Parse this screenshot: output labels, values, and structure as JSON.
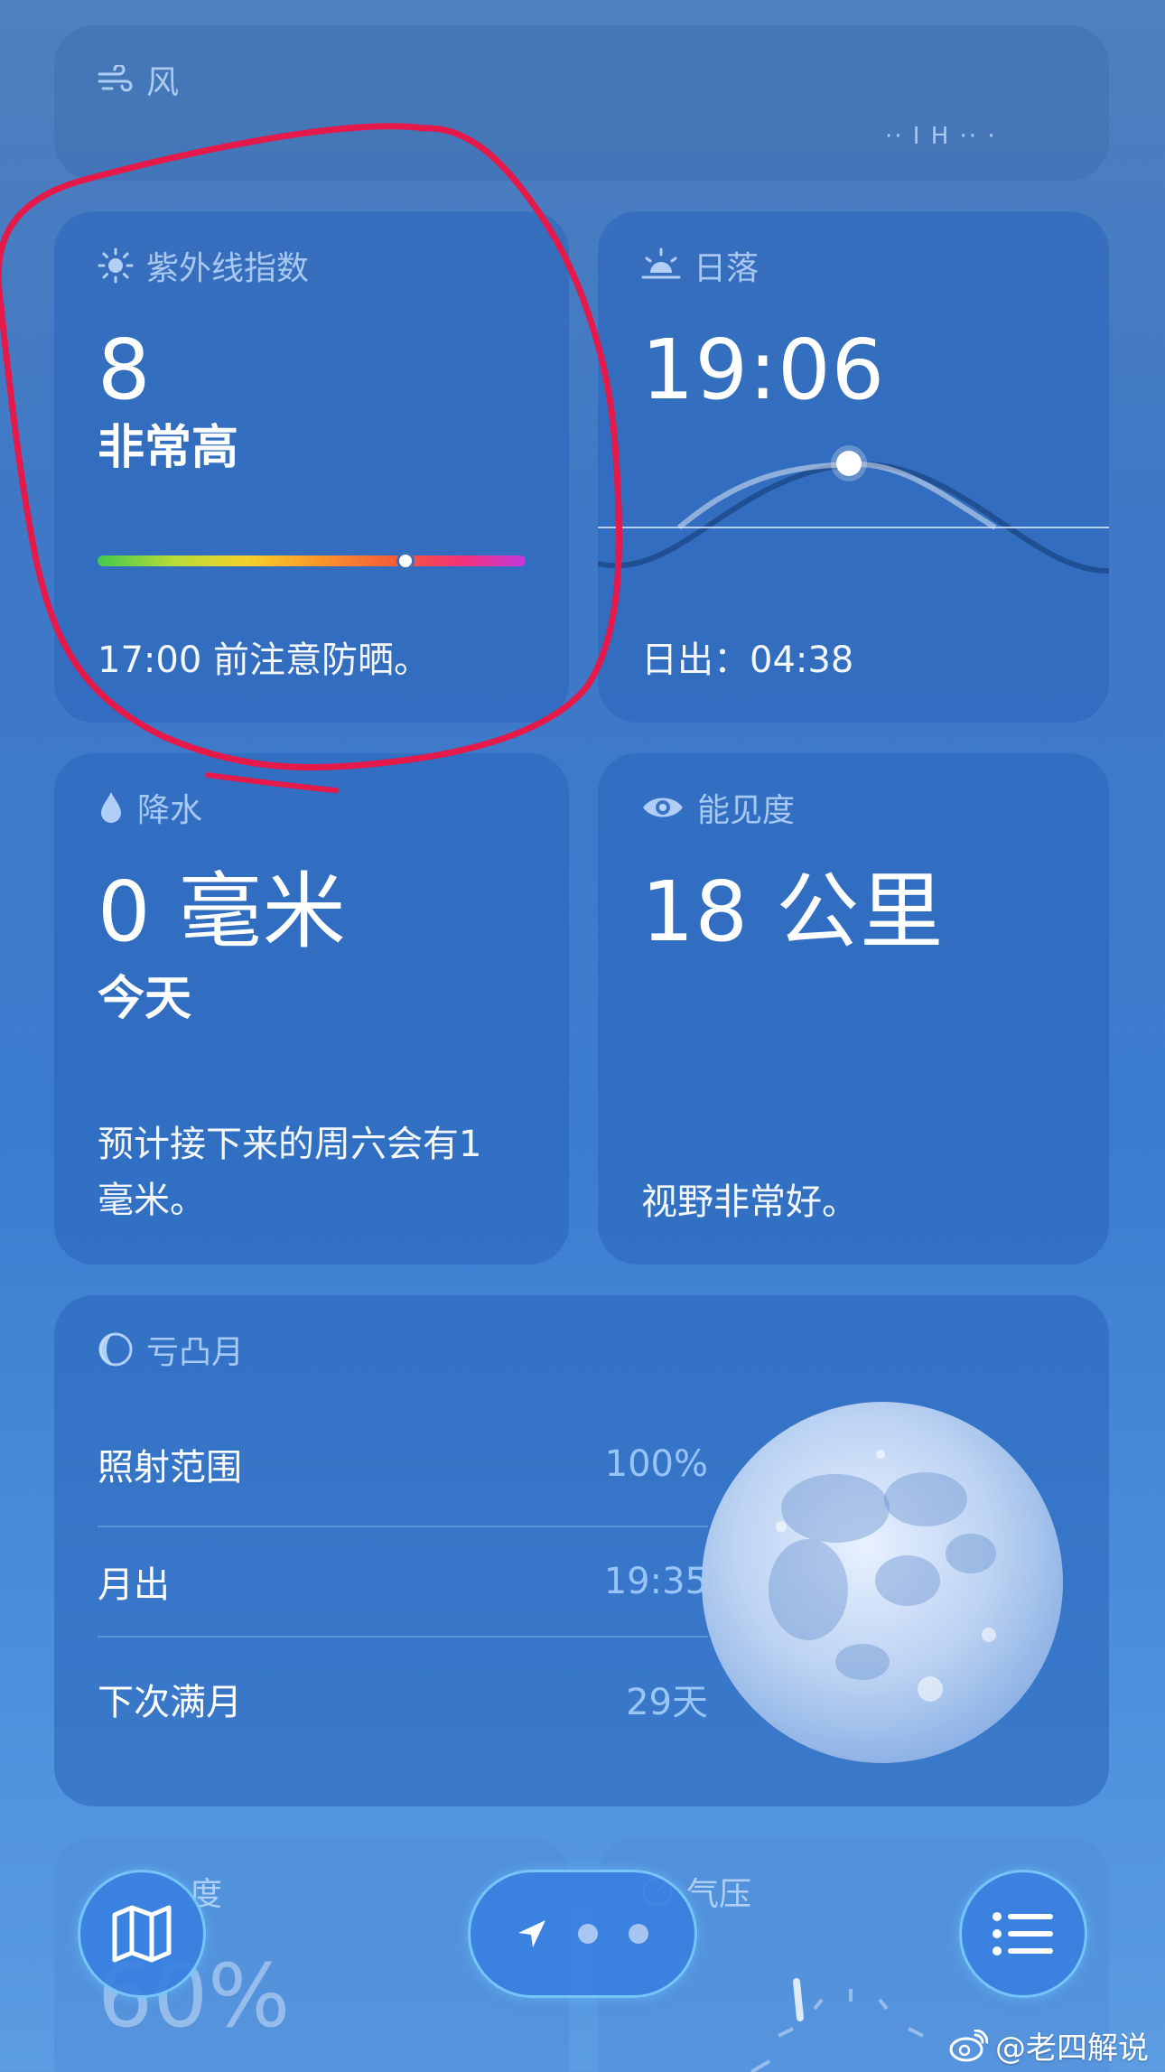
{
  "wind": {
    "label": "风",
    "faint_text": "·· I H ·· ·"
  },
  "uv": {
    "label": "紫外线指数",
    "value": "8",
    "level": "非常高",
    "note": "17:00 前注意防晒。",
    "bar_position": 0.72
  },
  "sunset": {
    "label": "日落",
    "time": "19:06",
    "sunrise": "日出：04:38"
  },
  "precipitation": {
    "label": "降水",
    "amount": "0 毫米",
    "period": "今天",
    "note": "预计接下来的周六会有1毫米。"
  },
  "visibility": {
    "label": "能见度",
    "value": "18 公里",
    "note": "视野非常好。"
  },
  "moon": {
    "label": "亏凸月",
    "rows": [
      {
        "name": "照射范围",
        "value": "100%"
      },
      {
        "name": "月出",
        "value": "19:35"
      },
      {
        "name": "下次满月",
        "value": "29天"
      }
    ]
  },
  "humidity": {
    "label": "度",
    "value": "60%"
  },
  "pressure": {
    "label": "气压"
  },
  "watermark": {
    "text": "@老四解说"
  },
  "colors": {
    "annotation": "#e5194a",
    "card": "#2f6fc0"
  },
  "icons": {
    "wind": "wind-icon",
    "uv": "sun-icon",
    "sunset": "sunset-icon",
    "precipitation": "raindrop-icon",
    "visibility": "eye-icon",
    "moon": "moon-phase-icon",
    "map": "map-icon",
    "location": "location-arrow-icon",
    "list": "list-icon"
  }
}
